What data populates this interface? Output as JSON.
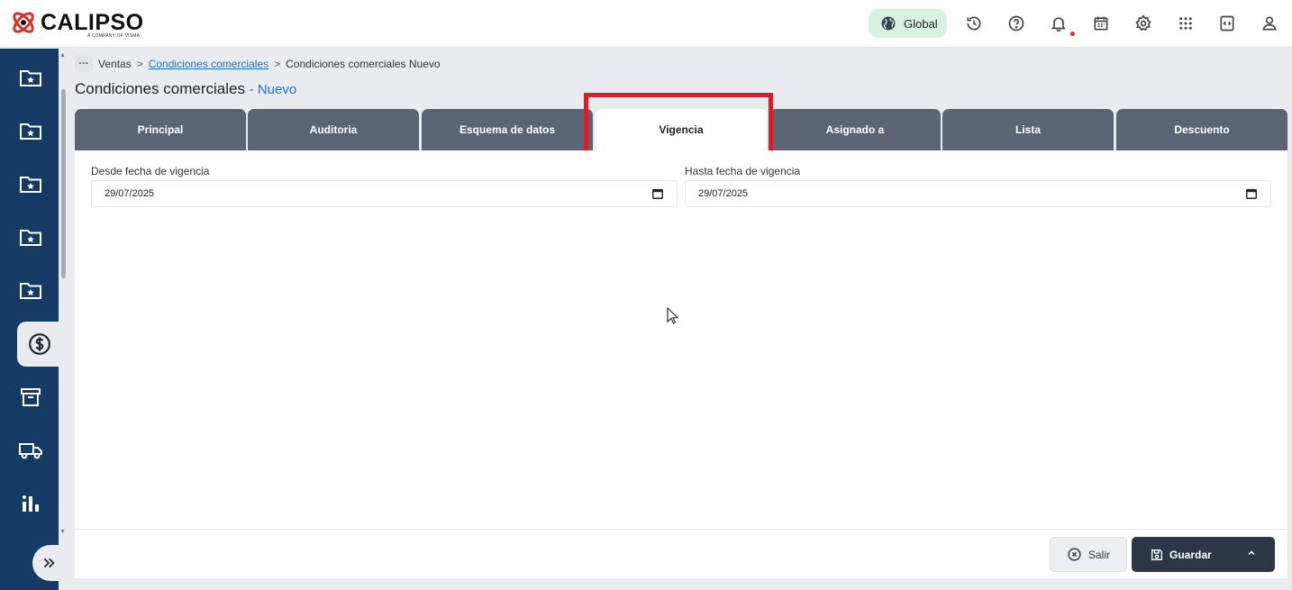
{
  "brand": {
    "name": "CALIPSO",
    "tagline": "A COMPANY OF VISMA",
    "mark_color": "#d9302c"
  },
  "topbar": {
    "global_label": "Global",
    "icons": [
      "globe-icon",
      "history-icon",
      "help-icon",
      "bell-icon",
      "calendar-icon",
      "gear-icon",
      "apps-grid-icon",
      "code-window-icon",
      "user-icon"
    ]
  },
  "sidebar": {
    "items": [
      {
        "icon": "folder-star-icon",
        "active": false
      },
      {
        "icon": "folder-star-icon",
        "active": false
      },
      {
        "icon": "folder-star-icon",
        "active": false
      },
      {
        "icon": "folder-star-icon",
        "active": false
      },
      {
        "icon": "folder-star-icon",
        "active": false
      },
      {
        "icon": "dollar-circle-icon",
        "active": true
      },
      {
        "icon": "archive-box-icon",
        "active": false
      },
      {
        "icon": "truck-icon",
        "active": false
      },
      {
        "icon": "bar-chart-icon",
        "active": false
      }
    ],
    "expand_icon": "double-chevron-right-icon"
  },
  "breadcrumb": {
    "dots": "···",
    "items": [
      "Ventas",
      "Condiciones comerciales",
      "Condiciones comerciales Nuevo"
    ],
    "separator": ">"
  },
  "page": {
    "title": "Condiciones comerciales",
    "subtitle": "- Nuevo"
  },
  "tabs": [
    {
      "label": "Principal",
      "active": false
    },
    {
      "label": "Auditoria",
      "active": false
    },
    {
      "label": "Esquema de datos",
      "active": false
    },
    {
      "label": "Vigencia",
      "active": true
    },
    {
      "label": "Asignado a",
      "active": false
    },
    {
      "label": "Lista",
      "active": false
    },
    {
      "label": "Descuento",
      "active": false
    }
  ],
  "form": {
    "desde": {
      "label": "Desde fecha de vigencia",
      "value": "29/07/2025"
    },
    "hasta": {
      "label": "Hasta fecha de vigencia",
      "value": "29/07/2025"
    }
  },
  "footer": {
    "salir_label": "Salir",
    "guardar_label": "Guardar"
  },
  "colors": {
    "sidebar_bg": "#153a63",
    "tab_bg": "#5b6473",
    "accent_link": "#1a73c9",
    "highlight_box": "#e01b24",
    "guardar_bg": "#2c3644",
    "global_bg": "#d9f1e1"
  }
}
